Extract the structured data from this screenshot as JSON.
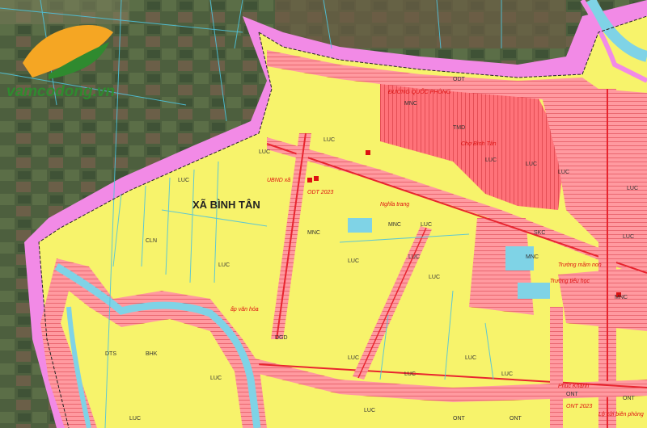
{
  "map": {
    "commune_label": "XÃ BÌNH TÂN",
    "logo": {
      "text": "vamcodong.vn",
      "colors": {
        "orange": "#f5a623",
        "green": "#2f8a2f"
      }
    },
    "colors": {
      "agri_land": "#f7f36b",
      "residential": "#ff9aa0",
      "urban_dense": "#ff5a6e",
      "border_pink": "#f28ae6",
      "canal_blue": "#7fd3e6",
      "road_red": "#e8252f",
      "satellite_base": "#4a5e3f"
    },
    "land_codes": [
      "LUC",
      "LUC",
      "LUC",
      "LUC",
      "LUC",
      "LUC",
      "LUC",
      "LUC",
      "LUC",
      "LUC",
      "LUC",
      "LUC",
      "LUC",
      "LUC",
      "LUC",
      "LUC",
      "LUC",
      "LUC",
      "LUC",
      "LUC",
      "MNC",
      "MNC",
      "MNC",
      "MNC",
      "MNC",
      "ONT",
      "ONT",
      "ONT",
      "ONT",
      "DTS",
      "SKC",
      "DGD",
      "CLN",
      "TMD",
      "BHK",
      "ODT"
    ],
    "annotations": [
      "Trường mầm non",
      "Chợ Bình Tân",
      "UBND xã",
      "ĐƯỜNG QUỐC PHÒNG",
      "Trường tiểu học",
      "ODT 2023",
      "ONT 2023",
      "Lộ cửi biên phòng",
      "ấp văn hóa",
      "Nghĩa trang",
      "Phúc Khánh"
    ]
  }
}
